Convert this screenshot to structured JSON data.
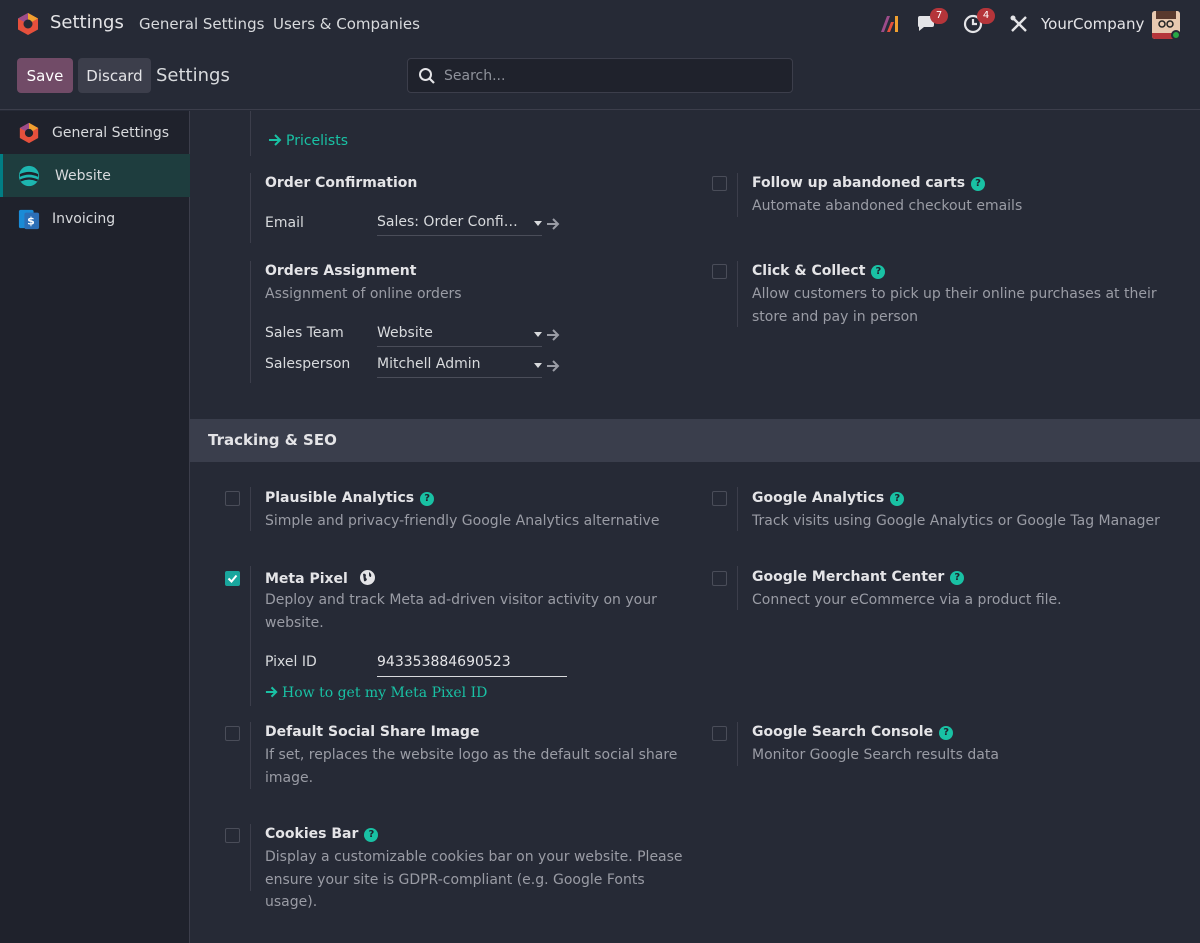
{
  "app": {
    "title": "Settings"
  },
  "nav": {
    "general": "General Settings",
    "users": "Users & Companies"
  },
  "systray": {
    "ai_icon": "ai-icon",
    "messages_count": "7",
    "activities_count": "4",
    "company": "YourCompany"
  },
  "control": {
    "save": "Save",
    "discard": "Discard",
    "breadcrumb": "Settings",
    "search_placeholder": "Search..."
  },
  "sidebar": {
    "items": [
      {
        "label": "General Settings",
        "icon": "odoo-logo-icon"
      },
      {
        "label": "Website",
        "icon": "website-icon",
        "active": true
      },
      {
        "label": "Invoicing",
        "icon": "invoicing-icon"
      }
    ]
  },
  "sales": {
    "pricelists_link": "Pricelists",
    "order_confirmation": {
      "title": "Order Confirmation",
      "email_label": "Email",
      "email_value": "Sales: Order Confirmation"
    },
    "abandoned_carts": {
      "title": "Follow up abandoned carts",
      "desc": "Automate abandoned checkout emails"
    },
    "orders_assignment": {
      "title": "Orders Assignment",
      "desc": "Assignment of online orders",
      "team_label": "Sales Team",
      "team_value": "Website",
      "person_label": "Salesperson",
      "person_value": "Mitchell Admin"
    },
    "click_collect": {
      "title": "Click & Collect",
      "desc": "Allow customers to pick up their online purchases at their store and pay in person"
    }
  },
  "tracking": {
    "section_title": "Tracking & SEO",
    "plausible": {
      "title": "Plausible Analytics",
      "desc": "Simple and privacy-friendly Google Analytics alternative"
    },
    "google_analytics": {
      "title": "Google Analytics",
      "desc": "Track visits using Google Analytics or Google Tag Manager"
    },
    "meta_pixel": {
      "title": "Meta Pixel",
      "desc": "Deploy and track Meta ad-driven visitor activity on your website.",
      "pixel_label": "Pixel ID",
      "pixel_value": "943353884690523",
      "help_link": "How to get my Meta Pixel ID",
      "checked": true
    },
    "merchant_center": {
      "title": "Google Merchant Center",
      "desc": "Connect your eCommerce via a product file."
    },
    "social_share": {
      "title": "Default Social Share Image",
      "desc": "If set, replaces the website logo as the default social share image."
    },
    "search_console": {
      "title": "Google Search Console",
      "desc": "Monitor Google Search results data"
    },
    "cookies_bar": {
      "title": "Cookies Bar",
      "desc": "Display a customizable cookies bar on your website. Please ensure your site is GDPR-compliant (e.g. Google Fonts usage)."
    }
  },
  "colors": {
    "accent": "#19C1A4",
    "primary": "#714B67",
    "bg": "#262A36",
    "sidebar_bg": "#1F222C",
    "badge": "#B5353A"
  }
}
